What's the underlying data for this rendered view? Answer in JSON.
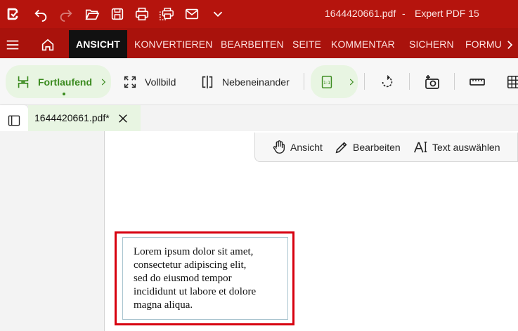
{
  "titlebar": {
    "filename": "1644420661.pdf",
    "separator": "-",
    "app_name": "Expert PDF 15"
  },
  "ribbon": {
    "tabs": [
      "ANSICHT",
      "KONVERTIEREN",
      "BEARBEITEN",
      "SEITE",
      "KOMMENTAR",
      "SICHERN",
      "FORMU"
    ],
    "active_tab": "ANSICHT"
  },
  "toolbar": {
    "continuous_label": "Fortlaufend",
    "fullscreen_label": "Vollbild",
    "side_by_side_label": "Nebeneinander"
  },
  "document_tab": {
    "label": "1644420661.pdf*"
  },
  "modes": {
    "view_label": "Ansicht",
    "edit_label": "Bearbeiten",
    "select_text_label": "Text auswählen"
  },
  "document": {
    "text_lines": [
      "Lorem ipsum dolor sit amet,",
      "consectetur adipiscing elit,",
      "sed do eiusmod tempor",
      "incididunt ut labore et dolore",
      "magna aliqua."
    ]
  },
  "colors": {
    "titlebar": "#b5140d",
    "tabsbar": "#a9120c",
    "accent_green": "#3a8a1e",
    "highlight_red": "#d7000f"
  }
}
